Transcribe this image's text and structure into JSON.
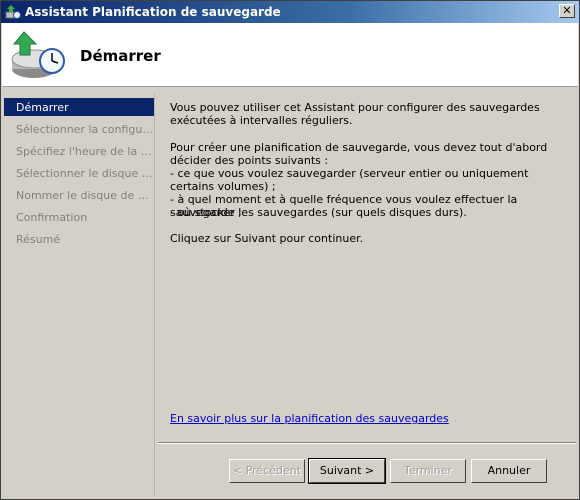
{
  "window": {
    "title": "Assistant Planification de sauvegarde",
    "close_glyph": "✕"
  },
  "header": {
    "title": "Démarrer",
    "icon": "backup-clock-icon"
  },
  "nav": {
    "items": [
      {
        "label": "Démarrer",
        "active": true
      },
      {
        "label": "Sélectionner la configu...",
        "active": false
      },
      {
        "label": "Spécifiez l'heure de la s...",
        "active": false
      },
      {
        "label": "Sélectionner le disque ...",
        "active": false
      },
      {
        "label": "Nommer le disque de d...",
        "active": false
      },
      {
        "label": "Confirmation",
        "active": false
      },
      {
        "label": "Résumé",
        "active": false
      }
    ]
  },
  "content": {
    "intro": "Vous pouvez utiliser cet Assistant pour configurer des sauvegardes exécutées à intervalles réguliers.",
    "decide": "Pour créer une planification de sauvegarde, vous devez tout d'abord décider des points suivants :",
    "bullet1": "-  ce que vous voulez sauvegarder (serveur entier ou uniquement certains volumes) ;",
    "bullet2": "-  à quel moment et à quelle fréquence vous voulez effectuer la sauvegarde ;",
    "bullet3": "-  où stocker les sauvegardes (sur quels disques durs).",
    "continue": "Cliquez sur Suivant pour continuer.",
    "learn_more": "En savoir plus sur la planification des sauvegardes"
  },
  "buttons": {
    "previous": "< Précédent",
    "next": "Suivant >",
    "finish": "Terminer",
    "cancel": "Annuler"
  },
  "colors": {
    "selection": "#0a246a",
    "link": "#0000cc",
    "face": "#d4d0c8"
  }
}
